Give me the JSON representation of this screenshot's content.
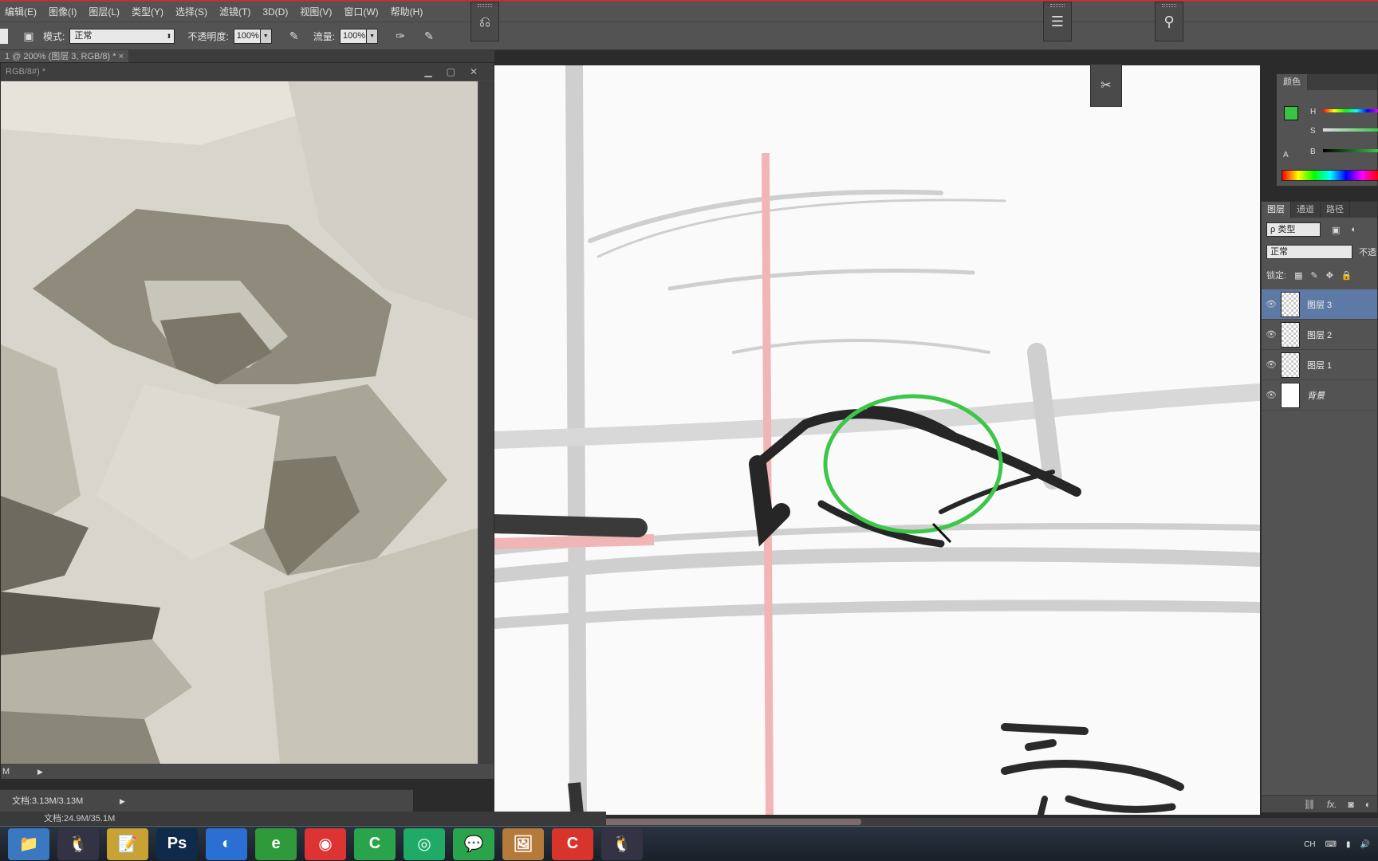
{
  "menu": [
    "编辑(E)",
    "图像(I)",
    "图层(L)",
    "类型(Y)",
    "选择(S)",
    "滤镜(T)",
    "3D(D)",
    "视图(V)",
    "窗口(W)",
    "帮助(H)"
  ],
  "options": {
    "mode_label": "模式:",
    "mode_value": "正常",
    "opacity_label": "不透明度:",
    "opacity_value": "100%",
    "flow_label": "流量:",
    "flow_value": "100%"
  },
  "document_tab": "1 @ 200% (图层 3, RGB/8) * ×",
  "ref_window": {
    "title": "RGB/8#) *",
    "status": "M",
    "doc_size": "文档:3.13M/3.13M"
  },
  "main_status": "文档:24.9M/35.1M",
  "color_panel": {
    "tab": "颜色",
    "h_label": "H",
    "s_label": "S",
    "b_label": "B",
    "fg_color": "#39c244"
  },
  "layers_panel": {
    "tabs": [
      "图层",
      "通道",
      "路径"
    ],
    "filter_label": "ρ 类型",
    "blend_mode": "正常",
    "opacity_short": "不透",
    "lock_label": "锁定:",
    "layers": [
      {
        "name": "图层 3",
        "selected": true,
        "thumb": "transparent"
      },
      {
        "name": "图层 2",
        "selected": false,
        "thumb": "transparent"
      },
      {
        "name": "图层 1",
        "selected": false,
        "thumb": "transparent"
      },
      {
        "name": "背景",
        "selected": false,
        "thumb": "white"
      }
    ],
    "footer_icons": [
      "link-icon",
      "fx-icon",
      "mask-icon",
      "adjustment-icon"
    ]
  },
  "taskbar": {
    "apps": [
      {
        "name": "explorer",
        "glyph": "📁",
        "color": "#3a78c2"
      },
      {
        "name": "qq",
        "glyph": "🐧",
        "color": "#334"
      },
      {
        "name": "notepad",
        "glyph": "📝",
        "color": "#c9a233"
      },
      {
        "name": "photoshop",
        "glyph": "Ps",
        "color": "#0f2a4a"
      },
      {
        "name": "browser",
        "glyph": "◐",
        "color": "#2a6fd1"
      },
      {
        "name": "browser-360",
        "glyph": "e",
        "color": "#2e9a3a"
      },
      {
        "name": "music",
        "glyph": "◉",
        "color": "#d33"
      },
      {
        "name": "camtasia",
        "glyph": "C",
        "color": "#2aa44a"
      },
      {
        "name": "iqiyi",
        "glyph": "◎",
        "color": "#1faa66"
      },
      {
        "name": "wechat",
        "glyph": "💬",
        "color": "#2aa44a"
      },
      {
        "name": "photo",
        "glyph": "🖼",
        "color": "#b57a3a"
      },
      {
        "name": "recorder",
        "glyph": "C",
        "color": "#d9342b"
      },
      {
        "name": "qq-2",
        "glyph": "🐧",
        "color": "#334"
      }
    ],
    "ime": "CH"
  }
}
